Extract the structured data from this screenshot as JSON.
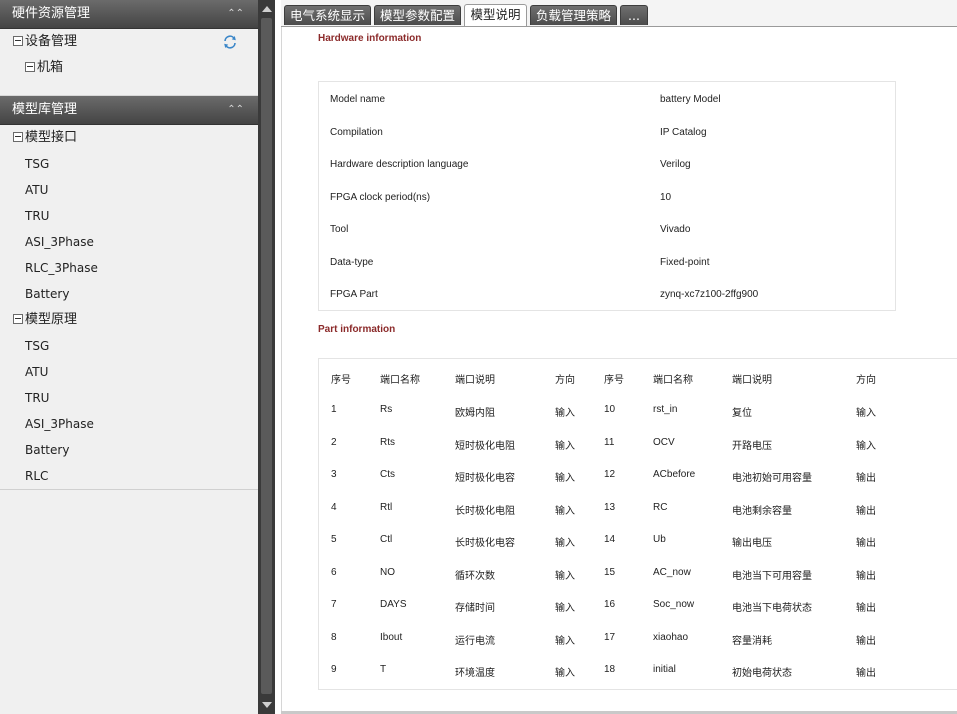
{
  "sidebar": {
    "panels": [
      {
        "title": "硬件资源管理",
        "collapse_icon": "double-chevron-up-icon",
        "refresh_icon": "refresh-icon",
        "items": [
          {
            "label": "设备管理",
            "level": 1,
            "expanded": true
          },
          {
            "label": "机箱",
            "level": 2,
            "expanded": true
          }
        ]
      },
      {
        "title": "模型库管理",
        "collapse_icon": "double-chevron-up-icon",
        "items": [
          {
            "label": "模型接口",
            "level": 1,
            "expanded": true
          },
          {
            "label": "TSG",
            "level": 2
          },
          {
            "label": "ATU",
            "level": 2
          },
          {
            "label": "TRU",
            "level": 2
          },
          {
            "label": "ASI_3Phase",
            "level": 2
          },
          {
            "label": "RLC_3Phase",
            "level": 2
          },
          {
            "label": "Battery",
            "level": 2
          },
          {
            "label": "模型原理",
            "level": 1,
            "expanded": true
          },
          {
            "label": "TSG",
            "level": 2
          },
          {
            "label": "ATU",
            "level": 2
          },
          {
            "label": "TRU",
            "level": 2
          },
          {
            "label": "ASI_3Phase",
            "level": 2
          },
          {
            "label": "Battery",
            "level": 2
          },
          {
            "label": "RLC",
            "level": 2
          }
        ]
      }
    ]
  },
  "tabs": [
    {
      "label": "电气系统显示",
      "active": false
    },
    {
      "label": "模型参数配置",
      "active": false
    },
    {
      "label": "模型说明",
      "active": true
    },
    {
      "label": "负载管理策略",
      "active": false
    },
    {
      "label": "...",
      "active": false
    }
  ],
  "hardware": {
    "title": "Hardware information",
    "rows": [
      {
        "label": "Model name",
        "value": "battery Model"
      },
      {
        "label": "Compilation",
        "value": "IP Catalog"
      },
      {
        "label": "Hardware description language",
        "value": "Verilog"
      },
      {
        "label": "FPGA clock period(ns)",
        "value": "10"
      },
      {
        "label": "Tool",
        "value": "Vivado"
      },
      {
        "label": "Data-type",
        "value": "Fixed-point"
      },
      {
        "label": "FPGA Part",
        "value": "zynq-xc7z100-2ffg900"
      }
    ]
  },
  "part": {
    "title": "Part information",
    "headers": [
      "序号",
      "端口名称",
      "端口说明",
      "方向",
      "序号",
      "端口名称",
      "端口说明",
      "方向"
    ],
    "rows": [
      [
        "1",
        "Rs",
        "欧姆内阻",
        "输入",
        "10",
        "rst_in",
        "复位",
        "输入"
      ],
      [
        "2",
        "Rts",
        "短时极化电阻",
        "输入",
        "11",
        "OCV",
        "开路电压",
        "输入"
      ],
      [
        "3",
        "Cts",
        "短时极化电容",
        "输入",
        "12",
        "ACbefore",
        "电池初始可用容量",
        "输出"
      ],
      [
        "4",
        "Rtl",
        "长时极化电阻",
        "输入",
        "13",
        "RC",
        "电池剩余容量",
        "输出"
      ],
      [
        "5",
        "Ctl",
        "长时极化电容",
        "输入",
        "14",
        "Ub",
        "输出电压",
        "输出"
      ],
      [
        "6",
        "NO",
        "循环次数",
        "输入",
        "15",
        "AC_now",
        "电池当下可用容量",
        "输出"
      ],
      [
        "7",
        "DAYS",
        "存储时间",
        "输入",
        "16",
        "Soc_now",
        "电池当下电荷状态",
        "输出"
      ],
      [
        "8",
        "Ibout",
        "运行电流",
        "输入",
        "17",
        "xiaohao",
        "容量消耗",
        "输出"
      ],
      [
        "9",
        "T",
        "环境温度",
        "输入",
        "18",
        "initial",
        "初始电荷状态",
        "输出"
      ]
    ]
  },
  "colors": {
    "panel_header": "#555555",
    "section_title": "#8b2a2a",
    "sidebar_bg": "#f0f0f0"
  }
}
